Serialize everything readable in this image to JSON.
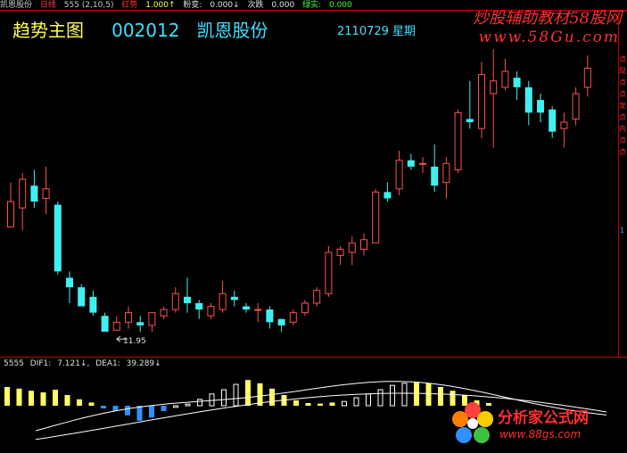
{
  "topbar": {
    "stock_name": "凯恩股份",
    "period": "日线",
    "params": "555 (2,10,5)",
    "hong_label": "红势",
    "hong_value": "1.000↑",
    "fen_label": "粉变:",
    "fen_value": "0.000↓",
    "ci_label": "次跌",
    "ci_value": "0.000",
    "lv_label": "绿实:",
    "lv_value": "0.000"
  },
  "headline": {
    "title": "趋势主图",
    "code": "002012",
    "name": "凯恩股份",
    "date": "2110729 星期"
  },
  "watermark": {
    "line1": "炒股辅助教材58股网",
    "line2": "www.58Gu.com"
  },
  "side_labels": {
    "red_chars": "点现点点龙点内点点",
    "blue_char": "1"
  },
  "low_marker": "11.95",
  "macd": {
    "label": "5555",
    "dif_label": "DIF1:",
    "dif_value": "7.121↓,",
    "dea_label": "DEA1:",
    "dea_value": "39.289↓"
  },
  "logo2": {
    "title": "分析家公式网",
    "url": "www.88gs.com"
  },
  "colors": {
    "up_candle": "#ff5050",
    "down_candle": "#40f0f0",
    "macd_yellow": "#ffff60",
    "macd_blue": "#3090ff",
    "macd_white": "#ffffff",
    "separator": "#c00000"
  },
  "chart_data": {
    "type": "candlestick",
    "price_low_label": 11.95,
    "candles": [
      {
        "o": 15.2,
        "c": 16.0,
        "h": 16.6,
        "l": 15.2,
        "up": true
      },
      {
        "o": 15.8,
        "c": 16.7,
        "h": 16.9,
        "l": 15.1,
        "up": true
      },
      {
        "o": 16.5,
        "c": 16.0,
        "h": 17.0,
        "l": 15.8,
        "up": false
      },
      {
        "o": 16.1,
        "c": 16.4,
        "h": 17.1,
        "l": 15.6,
        "up": true
      },
      {
        "o": 15.9,
        "c": 13.8,
        "h": 16.0,
        "l": 13.7,
        "up": false
      },
      {
        "o": 13.6,
        "c": 13.3,
        "h": 13.8,
        "l": 12.8,
        "up": false
      },
      {
        "o": 13.3,
        "c": 12.7,
        "h": 13.4,
        "l": 12.7,
        "up": false
      },
      {
        "o": 13.0,
        "c": 12.5,
        "h": 13.2,
        "l": 12.4,
        "up": false
      },
      {
        "o": 12.4,
        "c": 11.9,
        "h": 12.5,
        "l": 11.9,
        "up": false
      },
      {
        "o": 11.95,
        "c": 12.2,
        "h": 12.4,
        "l": 11.95,
        "up": true
      },
      {
        "o": 12.2,
        "c": 12.5,
        "h": 12.7,
        "l": 12.0,
        "up": true
      },
      {
        "o": 12.2,
        "c": 12.1,
        "h": 12.4,
        "l": 11.9,
        "up": false
      },
      {
        "o": 12.1,
        "c": 12.5,
        "h": 12.5,
        "l": 11.9,
        "up": true
      },
      {
        "o": 12.4,
        "c": 12.6,
        "h": 12.7,
        "l": 12.3,
        "up": true
      },
      {
        "o": 12.6,
        "c": 13.1,
        "h": 13.3,
        "l": 12.5,
        "up": true
      },
      {
        "o": 13.0,
        "c": 12.8,
        "h": 13.6,
        "l": 12.5,
        "up": false
      },
      {
        "o": 12.8,
        "c": 12.6,
        "h": 12.9,
        "l": 12.3,
        "up": false
      },
      {
        "o": 12.4,
        "c": 12.7,
        "h": 12.8,
        "l": 12.3,
        "up": true
      },
      {
        "o": 12.6,
        "c": 13.1,
        "h": 13.5,
        "l": 12.5,
        "up": true
      },
      {
        "o": 13.0,
        "c": 12.9,
        "h": 13.2,
        "l": 12.7,
        "up": false
      },
      {
        "o": 12.7,
        "c": 12.6,
        "h": 12.8,
        "l": 12.5,
        "up": false
      },
      {
        "o": 12.6,
        "c": 12.6,
        "h": 12.8,
        "l": 12.2,
        "up": true
      },
      {
        "o": 12.6,
        "c": 12.2,
        "h": 12.7,
        "l": 12.0,
        "up": false
      },
      {
        "o": 12.3,
        "c": 12.1,
        "h": 12.3,
        "l": 11.9,
        "up": false
      },
      {
        "o": 12.2,
        "c": 12.5,
        "h": 12.6,
        "l": 12.1,
        "up": true
      },
      {
        "o": 12.5,
        "c": 12.8,
        "h": 12.9,
        "l": 12.4,
        "up": true
      },
      {
        "o": 12.8,
        "c": 13.2,
        "h": 13.3,
        "l": 12.7,
        "up": true
      },
      {
        "o": 13.1,
        "c": 14.4,
        "h": 14.6,
        "l": 13.0,
        "up": true
      },
      {
        "o": 14.3,
        "c": 14.5,
        "h": 14.6,
        "l": 14.0,
        "up": true
      },
      {
        "o": 14.4,
        "c": 14.7,
        "h": 14.9,
        "l": 14.0,
        "up": true
      },
      {
        "o": 14.5,
        "c": 14.8,
        "h": 15.0,
        "l": 14.3,
        "up": true
      },
      {
        "o": 14.7,
        "c": 16.3,
        "h": 16.4,
        "l": 14.7,
        "up": true
      },
      {
        "o": 16.3,
        "c": 16.1,
        "h": 16.6,
        "l": 16.0,
        "up": false
      },
      {
        "o": 16.4,
        "c": 17.3,
        "h": 17.6,
        "l": 16.2,
        "up": true
      },
      {
        "o": 17.3,
        "c": 17.1,
        "h": 17.5,
        "l": 17.0,
        "up": false
      },
      {
        "o": 17.2,
        "c": 17.2,
        "h": 17.4,
        "l": 16.9,
        "up": true
      },
      {
        "o": 17.1,
        "c": 16.5,
        "h": 17.8,
        "l": 16.3,
        "up": false
      },
      {
        "o": 16.6,
        "c": 17.2,
        "h": 17.4,
        "l": 16.1,
        "up": true
      },
      {
        "o": 17.0,
        "c": 18.8,
        "h": 18.9,
        "l": 16.9,
        "up": true
      },
      {
        "o": 18.6,
        "c": 18.5,
        "h": 19.8,
        "l": 18.3,
        "up": false
      },
      {
        "o": 18.3,
        "c": 20.0,
        "h": 20.4,
        "l": 18.0,
        "up": true
      },
      {
        "o": 19.4,
        "c": 19.8,
        "h": 20.8,
        "l": 17.7,
        "up": true
      },
      {
        "o": 19.6,
        "c": 20.1,
        "h": 20.5,
        "l": 19.5,
        "up": true
      },
      {
        "o": 19.9,
        "c": 19.6,
        "h": 20.1,
        "l": 19.2,
        "up": false
      },
      {
        "o": 19.6,
        "c": 18.8,
        "h": 19.8,
        "l": 18.4,
        "up": false
      },
      {
        "o": 19.2,
        "c": 18.8,
        "h": 19.4,
        "l": 18.5,
        "up": false
      },
      {
        "o": 18.9,
        "c": 18.2,
        "h": 19.0,
        "l": 18.0,
        "up": false
      },
      {
        "o": 18.3,
        "c": 18.5,
        "h": 18.8,
        "l": 17.7,
        "up": true
      },
      {
        "o": 18.6,
        "c": 19.4,
        "h": 19.6,
        "l": 18.4,
        "up": true
      },
      {
        "o": 19.6,
        "c": 20.2,
        "h": 20.6,
        "l": 19.3,
        "up": true
      }
    ],
    "macd_bars": [
      {
        "v": 0.35,
        "c": "yellow"
      },
      {
        "v": 0.32,
        "c": "yellow"
      },
      {
        "v": 0.28,
        "c": "yellow"
      },
      {
        "v": 0.25,
        "c": "yellow"
      },
      {
        "v": 0.3,
        "c": "yellow"
      },
      {
        "v": 0.2,
        "c": "yellow"
      },
      {
        "v": 0.12,
        "c": "yellow"
      },
      {
        "v": 0.06,
        "c": "yellow"
      },
      {
        "v": -0.05,
        "c": "blue"
      },
      {
        "v": -0.1,
        "c": "blue"
      },
      {
        "v": -0.18,
        "c": "blue"
      },
      {
        "v": -0.28,
        "c": "blue"
      },
      {
        "v": -0.22,
        "c": "blue"
      },
      {
        "v": -0.1,
        "c": "blue"
      },
      {
        "v": -0.03,
        "c": "white"
      },
      {
        "v": 0.03,
        "c": "white"
      },
      {
        "v": 0.12,
        "c": "white"
      },
      {
        "v": 0.22,
        "c": "white"
      },
      {
        "v": 0.3,
        "c": "white"
      },
      {
        "v": 0.4,
        "c": "white"
      },
      {
        "v": 0.48,
        "c": "yellow"
      },
      {
        "v": 0.42,
        "c": "yellow"
      },
      {
        "v": 0.32,
        "c": "yellow"
      },
      {
        "v": 0.2,
        "c": "yellow"
      },
      {
        "v": 0.1,
        "c": "yellow"
      },
      {
        "v": 0.05,
        "c": "yellow"
      },
      {
        "v": 0.04,
        "c": "yellow"
      },
      {
        "v": 0.06,
        "c": "yellow"
      },
      {
        "v": 0.08,
        "c": "white"
      },
      {
        "v": 0.15,
        "c": "white"
      },
      {
        "v": 0.22,
        "c": "white"
      },
      {
        "v": 0.3,
        "c": "white"
      },
      {
        "v": 0.38,
        "c": "white"
      },
      {
        "v": 0.42,
        "c": "white"
      },
      {
        "v": 0.45,
        "c": "yellow"
      },
      {
        "v": 0.42,
        "c": "yellow"
      },
      {
        "v": 0.35,
        "c": "yellow"
      },
      {
        "v": 0.28,
        "c": "yellow"
      },
      {
        "v": 0.2,
        "c": "yellow"
      },
      {
        "v": 0.1,
        "c": "yellow"
      },
      {
        "v": 0.05,
        "c": "yellow"
      }
    ]
  }
}
